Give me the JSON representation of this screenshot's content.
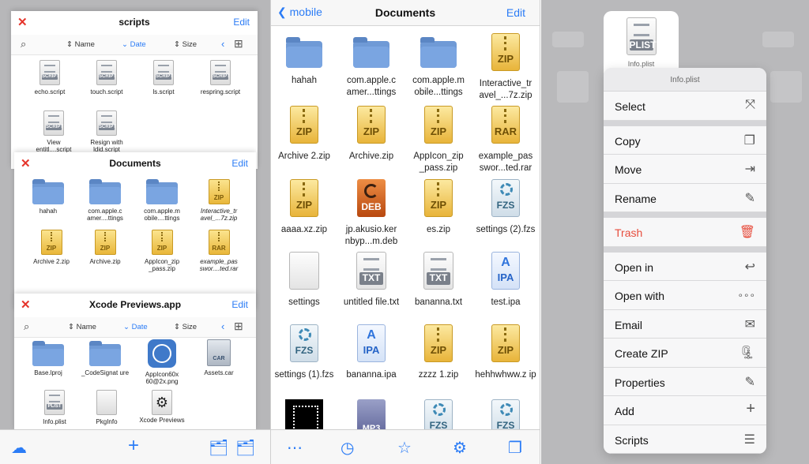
{
  "left": {
    "cards": [
      {
        "title": "scripts",
        "close": "✕",
        "edit": "Edit",
        "sort": {
          "name": "Name",
          "date": "Date",
          "size": "Size"
        },
        "items": [
          {
            "label": "echo.script",
            "kind": "script",
            "tag": "SCRIPT"
          },
          {
            "label": "touch.script",
            "kind": "script",
            "tag": "SCRIPT"
          },
          {
            "label": "ls.script",
            "kind": "script",
            "tag": "SCRIPT"
          },
          {
            "label": "respring.script",
            "kind": "script",
            "tag": "SCRIPT"
          },
          {
            "label": "View entitl....script",
            "kind": "script",
            "tag": "SCRIPT"
          },
          {
            "label": "Resign with ldid.script",
            "kind": "script",
            "tag": "SCRIPT"
          }
        ]
      },
      {
        "title": "Documents",
        "close": "✕",
        "edit": "Edit",
        "items": [
          {
            "label": "hahah",
            "kind": "folder"
          },
          {
            "label": "com.apple.c amer....ttings",
            "kind": "folder"
          },
          {
            "label": "com.apple.m obile....ttings",
            "kind": "folder"
          },
          {
            "label": "Interactive_tr avel_...7z.zip",
            "kind": "zip",
            "tag": "ZIP"
          },
          {
            "label": "Archive 2.zip",
            "kind": "zip",
            "tag": "ZIP"
          },
          {
            "label": "Archive.zip",
            "kind": "zip",
            "tag": "ZIP"
          },
          {
            "label": "AppIcon_zip _pass.zip",
            "kind": "zip",
            "tag": "ZIP"
          },
          {
            "label": "example_pas swor....ted.rar",
            "kind": "zip",
            "tag": "RAR"
          }
        ]
      },
      {
        "title": "Xcode Previews.app",
        "close": "✕",
        "edit": "Edit",
        "sort": {
          "name": "Name",
          "date": "Date",
          "size": "Size"
        },
        "items": [
          {
            "label": "Base.lproj",
            "kind": "folder"
          },
          {
            "label": "_CodeSignat ure",
            "kind": "folder"
          },
          {
            "label": "AppIcon60x 60@2x.png",
            "kind": "app"
          },
          {
            "label": "Assets.car",
            "kind": "car",
            "tag": "CAR"
          },
          {
            "label": "Info.plist",
            "kind": "script",
            "tag": "PLIST"
          },
          {
            "label": "PkgInfo",
            "kind": "blank"
          },
          {
            "label": "Xcode Previews",
            "kind": "gear"
          }
        ]
      }
    ],
    "toolbar": {
      "cloud": "☁",
      "add": "+",
      "folder_a": "🗂",
      "folder_b": "🗂"
    }
  },
  "middle": {
    "back": "mobile",
    "title": "Documents",
    "edit": "Edit",
    "items": [
      {
        "label": "hahah",
        "kind": "folder"
      },
      {
        "label": "com.apple.c amer...ttings",
        "kind": "folder"
      },
      {
        "label": "com.apple.m obile...ttings",
        "kind": "folder"
      },
      {
        "label": "Interactive_tr avel_...7z.zip",
        "kind": "zip",
        "tag": "ZIP"
      },
      {
        "label": "Archive 2.zip",
        "kind": "zip",
        "tag": "ZIP"
      },
      {
        "label": "Archive.zip",
        "kind": "zip",
        "tag": "ZIP"
      },
      {
        "label": "AppIcon_zip _pass.zip",
        "kind": "zip",
        "tag": "ZIP"
      },
      {
        "label": "example_pas swor...ted.rar",
        "kind": "zip",
        "tag": "RAR"
      },
      {
        "label": "aaaa.xz.zip",
        "kind": "zip",
        "tag": "ZIP"
      },
      {
        "label": "jp.akusio.ker nbyp...m.deb",
        "kind": "deb",
        "tag": "DEB"
      },
      {
        "label": "es.zip",
        "kind": "zip",
        "tag": "ZIP"
      },
      {
        "label": "settings (2).fzs",
        "kind": "fzs",
        "tag": "FZS"
      },
      {
        "label": "settings",
        "kind": "blank"
      },
      {
        "label": "untitled file.txt",
        "kind": "txt",
        "tag": "TXT"
      },
      {
        "label": "bananna.txt",
        "kind": "txt",
        "tag": "TXT"
      },
      {
        "label": "test.ipa",
        "kind": "ipa",
        "tag": "IPA"
      },
      {
        "label": "settings (1).fzs",
        "kind": "fzs",
        "tag": "FZS"
      },
      {
        "label": "bananna.ipa",
        "kind": "ipa",
        "tag": "IPA"
      },
      {
        "label": "zzzz 1.zip",
        "kind": "zip",
        "tag": "ZIP"
      },
      {
        "label": "hehhwhww.z ip",
        "kind": "zip",
        "tag": "ZIP"
      },
      {
        "label": "",
        "kind": "image"
      },
      {
        "label": "",
        "kind": "mp3",
        "tag": "MP3"
      },
      {
        "label": "",
        "kind": "fzs",
        "tag": "FZS"
      },
      {
        "label": "",
        "kind": "fzs",
        "tag": "FZS"
      }
    ],
    "toolbar": {
      "downloads": "⋯",
      "history": "◷",
      "favorites": "☆",
      "settings": "⚙",
      "tabs": "❐"
    }
  },
  "right": {
    "preview": {
      "tag": "PLIST",
      "caption": "Info.plist"
    },
    "menu_title": "Info.plist",
    "groups": [
      [
        {
          "label": "Select",
          "icon": "⤧"
        }
      ],
      [
        {
          "label": "Copy",
          "icon": "❐"
        },
        {
          "label": "Move",
          "icon": "⇥"
        },
        {
          "label": "Rename",
          "icon": "✎"
        }
      ],
      [
        {
          "label": "Trash",
          "icon": "🗑",
          "danger": true
        }
      ],
      [
        {
          "label": "Open in",
          "icon": "↩"
        },
        {
          "label": "Open with",
          "icon": "∘∘∘"
        },
        {
          "label": "Email",
          "icon": "✉"
        },
        {
          "label": "Create ZIP",
          "icon": "🗜"
        },
        {
          "label": "Properties",
          "icon": "✎"
        },
        {
          "label": "Add",
          "icon": "+"
        },
        {
          "label": "Scripts",
          "icon": "☰"
        }
      ]
    ]
  },
  "colors": {
    "accent": "#2b7cf6",
    "danger": "#e74c3c",
    "close": "#e5342b"
  }
}
